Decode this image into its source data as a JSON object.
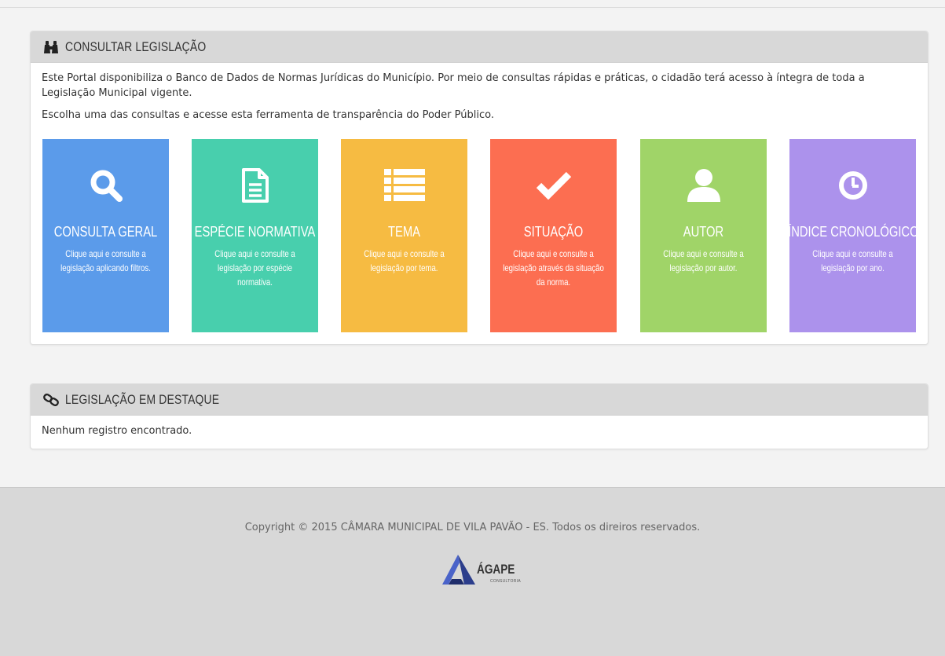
{
  "panel1": {
    "title": "CONSULTAR LEGISLAÇÃO",
    "icon": "binoculars-icon",
    "intro": "Este Portal disponibiliza o Banco de Dados de Normas Jurídicas do Município. Por meio de consultas rápidas e práticas, o cidadão terá acesso à íntegra de toda a Legislação Municipal vigente.",
    "prompt": "Escolha uma das consultas e acesse esta ferramenta de transparência do Poder Público."
  },
  "tiles": [
    {
      "title": "CONSULTA GERAL",
      "desc": "Clique aqui e consulte a legislação aplicando filtros.",
      "icon": "search-icon",
      "color": "#5b9bea"
    },
    {
      "title": "ESPÉCIE NORMATIVA",
      "desc": "Clique aqui e consulte a legislação por espécie normativa.",
      "icon": "document-icon",
      "color": "#48cfad"
    },
    {
      "title": "TEMA",
      "desc": "Clique aqui e consulte a legislação por tema.",
      "icon": "list-icon",
      "color": "#f6bb42"
    },
    {
      "title": "SITUAÇÃO",
      "desc": "Clique aqui e consulte a legislação através da situação da norma.",
      "icon": "check-icon",
      "color": "#fc6e51"
    },
    {
      "title": "AUTOR",
      "desc": "Clique aqui e consulte a legislação por autor.",
      "icon": "user-icon",
      "color": "#a0d468"
    },
    {
      "title": "ÍNDICE CRONOLÓGICO",
      "desc": "Clique aqui e consulte a legislação por ano.",
      "icon": "clock-icon",
      "color": "#ac92ec"
    }
  ],
  "panel2": {
    "title": "LEGISLAÇÃO EM DESTAQUE",
    "icon": "link-icon",
    "empty_text": "Nenhum registro encontrado."
  },
  "footer": {
    "copyright": "Copyright © 2015 CÂMARA MUNICIPAL DE VILA PAVÃO - ES. Todos os direiros reservados.",
    "logo_text": "ÁGAPE",
    "logo_sub": "CONSULTORIA"
  },
  "colors": {
    "panel_header": "#d8d8d8",
    "footer": "#d8d8d8",
    "background": "#f3f3f3"
  }
}
